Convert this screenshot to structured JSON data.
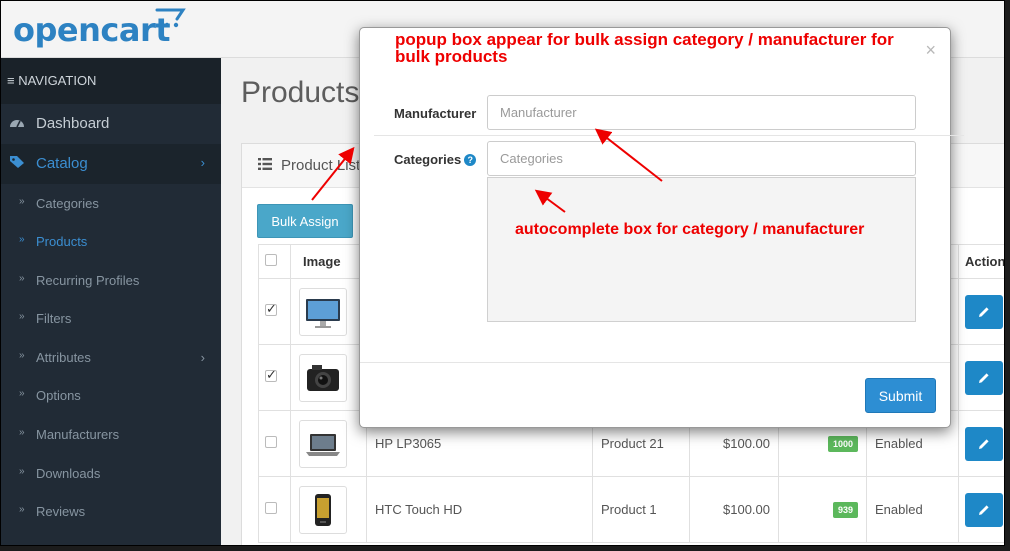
{
  "header": {
    "logo_text": "opencart"
  },
  "sidebar": {
    "nav_title": "≡ NAVIGATION",
    "dashboard": "Dashboard",
    "catalog": "Catalog",
    "sub_items": [
      "Categories",
      "Products",
      "Recurring Profiles",
      "Filters",
      "Attributes",
      "Options",
      "Manufacturers",
      "Downloads",
      "Reviews"
    ]
  },
  "content": {
    "page_title": "Products",
    "panel_title": "Product List",
    "bulk_assign_label": "Bulk Assign",
    "table": {
      "headers": {
        "image": "Image",
        "action": "Action"
      },
      "rows": [
        {
          "name": "",
          "model": "",
          "price": "",
          "quantity": "",
          "status": "",
          "checked": true,
          "thumb": "monitor-image"
        },
        {
          "name": "",
          "model": "",
          "price": "",
          "quantity": "",
          "status": "",
          "checked": true,
          "thumb": "camera-image"
        },
        {
          "name": "HP LP3065",
          "model": "Product 21",
          "price": "$100.00",
          "quantity": "1000",
          "status": "Enabled",
          "checked": false,
          "thumb": "laptop-image"
        },
        {
          "name": "HTC Touch HD",
          "model": "Product 1",
          "price": "$100.00",
          "quantity": "939",
          "status": "Enabled",
          "checked": false,
          "thumb": "phone-image"
        }
      ]
    }
  },
  "modal": {
    "close_glyph": "×",
    "manufacturer_label": "Manufacturer",
    "manufacturer_placeholder": "Manufacturer",
    "categories_label": "Categories",
    "categories_placeholder": "Categories",
    "help_glyph": "?",
    "submit_label": "Submit"
  },
  "annotations": {
    "popup_note_line1": "popup box appear for bulk assign category / manufacturer for",
    "popup_note_line2": "bulk products",
    "autocomplete_note": "autocomplete box for category / manufacturer",
    "color": "#ee0000"
  },
  "colors": {
    "accent": "#1e88c7",
    "sidebar_bg": "#212b36",
    "badge": "#5cb85c"
  }
}
